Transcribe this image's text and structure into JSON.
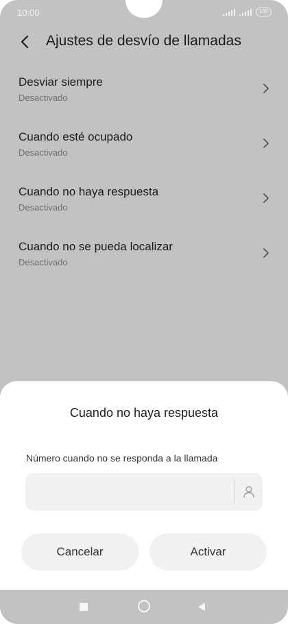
{
  "status_bar": {
    "time": "10:00",
    "battery": "100"
  },
  "header": {
    "title": "Ajustes de desvío de llamadas"
  },
  "list": {
    "items": [
      {
        "label": "Desviar siempre",
        "status": "Desactivado"
      },
      {
        "label": "Cuando esté ocupado",
        "status": "Desactivado"
      },
      {
        "label": "Cuando no haya respuesta",
        "status": "Desactivado"
      },
      {
        "label": "Cuando no se pueda localizar",
        "status": "Desactivado"
      }
    ]
  },
  "dialog": {
    "title": "Cuando no haya respuesta",
    "field_label": "Número cuando no se responda a la llamada",
    "field_value": "",
    "cancel_label": "Cancelar",
    "activate_label": "Activar"
  },
  "icons": {
    "back": "back-arrow-icon",
    "chevron": "chevron-right-icon",
    "contact": "contact-person-icon",
    "nav_recents": "square-icon",
    "nav_home": "circle-icon",
    "nav_back": "triangle-back-icon"
  },
  "colors": {
    "dimmed_background": "#c2c2c2",
    "sheet": "#ffffff",
    "button_fill": "#f1f1f1"
  }
}
